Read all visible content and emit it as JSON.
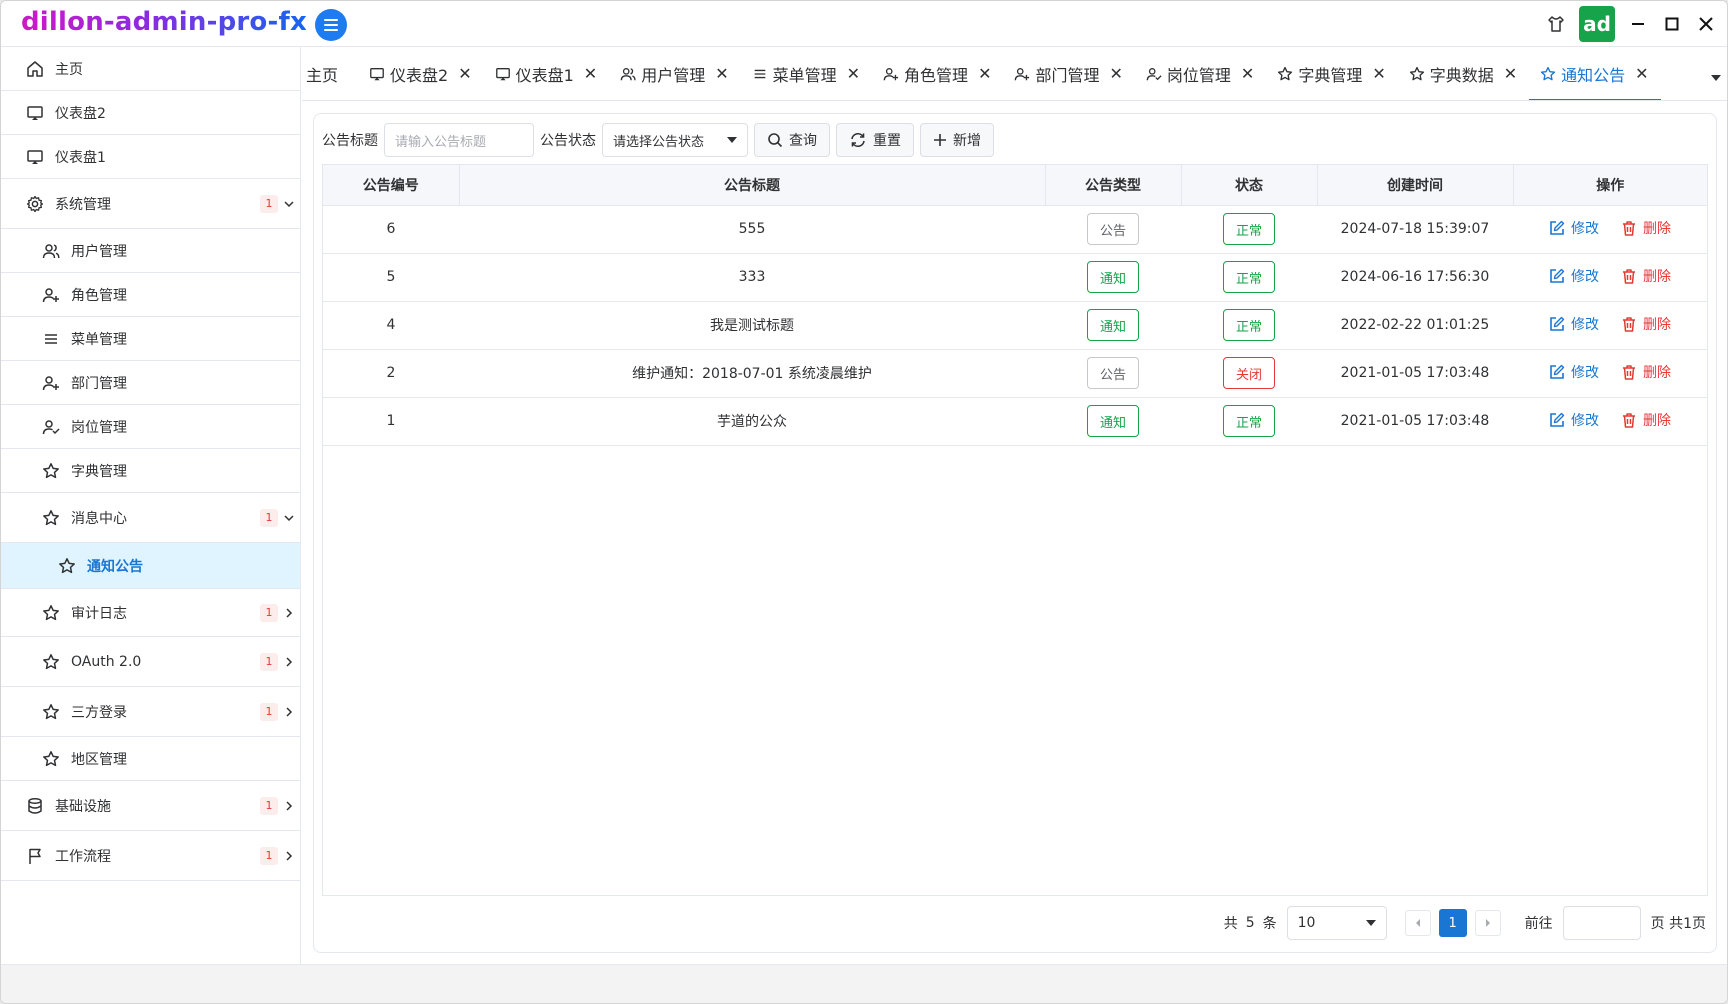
{
  "app": {
    "title": "dillon-admin-pro-fx",
    "avatar_text": "ad"
  },
  "colors": {
    "accent": "#1976d2",
    "success": "#16a34a",
    "danger": "#e53935",
    "active_bg": "#dff4ff"
  },
  "sidebar": {
    "items": [
      {
        "label": "主页",
        "icon": "home-icon"
      },
      {
        "label": "仪表盘2",
        "icon": "monitor-icon"
      },
      {
        "label": "仪表盘1",
        "icon": "monitor-icon"
      },
      {
        "label": "系统管理",
        "icon": "gear-icon",
        "badge": "1",
        "expanded": true
      },
      {
        "label": "用户管理",
        "icon": "users-icon"
      },
      {
        "label": "角色管理",
        "icon": "user-plus-icon"
      },
      {
        "label": "菜单管理",
        "icon": "menu-icon"
      },
      {
        "label": "部门管理",
        "icon": "user-plus-icon"
      },
      {
        "label": "岗位管理",
        "icon": "user-check-icon"
      },
      {
        "label": "字典管理",
        "icon": "star-icon"
      },
      {
        "label": "消息中心",
        "icon": "star-icon",
        "badge": "1",
        "expanded": true
      },
      {
        "label": "通知公告",
        "icon": "star-icon",
        "active": true
      },
      {
        "label": "审计日志",
        "icon": "star-icon",
        "badge": "1"
      },
      {
        "label": "OAuth 2.0",
        "icon": "star-icon",
        "badge": "1"
      },
      {
        "label": "三方登录",
        "icon": "star-icon",
        "badge": "1"
      },
      {
        "label": "地区管理",
        "icon": "star-icon"
      },
      {
        "label": "基础设施",
        "icon": "database-icon",
        "badge": "1"
      },
      {
        "label": "工作流程",
        "icon": "flag-icon",
        "badge": "1"
      }
    ]
  },
  "tabs": [
    {
      "label": "主页"
    },
    {
      "label": "仪表盘2",
      "icon": "monitor-icon"
    },
    {
      "label": "仪表盘1",
      "icon": "monitor-icon"
    },
    {
      "label": "用户管理",
      "icon": "users-icon"
    },
    {
      "label": "菜单管理",
      "icon": "menu-icon"
    },
    {
      "label": "角色管理",
      "icon": "user-plus-icon"
    },
    {
      "label": "部门管理",
      "icon": "user-plus-icon"
    },
    {
      "label": "岗位管理",
      "icon": "user-check-icon"
    },
    {
      "label": "字典管理",
      "icon": "star-icon"
    },
    {
      "label": "字典数据",
      "icon": "star-icon"
    },
    {
      "label": "通知公告",
      "icon": "star-icon",
      "active": true
    }
  ],
  "search": {
    "title_label": "公告标题",
    "title_placeholder": "请输入公告标题",
    "status_label": "公告状态",
    "status_placeholder": "请选择公告状态",
    "query_button": "查询",
    "reset_button": "重置",
    "add_button": "新增"
  },
  "table": {
    "columns": [
      "公告编号",
      "公告标题",
      "公告类型",
      "状态",
      "创建时间",
      "操作"
    ],
    "rows": [
      {
        "id": "6",
        "title": "555",
        "type": "公告",
        "status": "正常",
        "created": "2024-07-18 15:39:07"
      },
      {
        "id": "5",
        "title": "333",
        "type": "通知",
        "status": "正常",
        "created": "2024-06-16 17:56:30"
      },
      {
        "id": "4",
        "title": "我是测试标题",
        "type": "通知",
        "status": "正常",
        "created": "2022-02-22 01:01:25"
      },
      {
        "id": "2",
        "title": "维护通知：2018-07-01 系统凌晨维护",
        "type": "公告",
        "status": "关闭",
        "created": "2021-01-05 17:03:48"
      },
      {
        "id": "1",
        "title": "芋道的公众",
        "type": "通知",
        "status": "正常",
        "created": "2021-01-05 17:03:48"
      }
    ],
    "edit_label": "修改",
    "delete_label": "删除"
  },
  "pager": {
    "total_prefix": "共",
    "total": "5",
    "total_suffix": "条",
    "page_size": "10",
    "current_page": "1",
    "goto_label": "前往",
    "pages_suffix": "页 共1页"
  }
}
